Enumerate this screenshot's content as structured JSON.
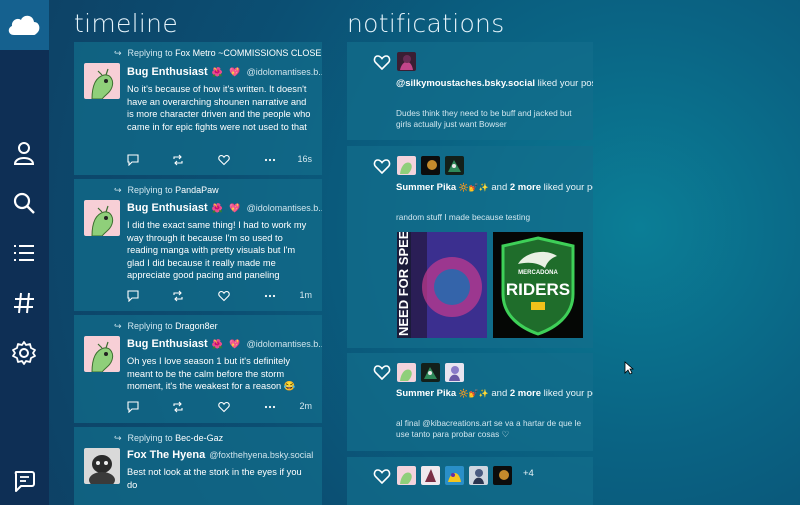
{
  "sections": {
    "timeline": "timeline",
    "notifications": "notifications"
  },
  "sidebar": {
    "items": [
      {
        "icon": "profile-icon"
      },
      {
        "icon": "search-icon"
      },
      {
        "icon": "list-icon"
      },
      {
        "icon": "hashtag-icon"
      },
      {
        "icon": "gear-icon"
      },
      {
        "icon": "compose-message-icon"
      }
    ]
  },
  "timeline": {
    "posts": [
      {
        "replying_to_label": "Replying to",
        "replying_to": "Fox Metro ~COMMISSIONS CLOSE...",
        "name": "Bug Enthusiast",
        "emoji": "🌺 💖",
        "handle": "@idolomantises.b...",
        "text": "No it's because of how it's written. It doesn't have an overarching shounen narrative and is more character driven and the people who came in for epic fights were not used to that",
        "time": "16s"
      },
      {
        "replying_to_label": "Replying to",
        "replying_to": "PandaPaw",
        "name": "Bug Enthusiast",
        "emoji": "🌺 💖",
        "handle": "@idolomantises.b...",
        "text": "I did the exact same thing! I had to work my way through it because I'm so used to reading manga with pretty visuals but I'm glad I did because it really made me appreciate good pacing and paneling",
        "time": "1m"
      },
      {
        "replying_to_label": "Replying to",
        "replying_to": "Dragon8er",
        "name": "Bug Enthusiast",
        "emoji": "🌺 💖",
        "handle": "@idolomantises.b...",
        "text": "Oh yes I love season 1 but it's definitely meant to be the calm before the storm moment, it's the weakest for a reason 😂",
        "time": "2m"
      },
      {
        "replying_to_label": "Replying to",
        "replying_to": "Bec-de-Gaz",
        "name": "Fox The Hyena",
        "emoji": "",
        "handle": "@foxthehyena.bsky.social",
        "text": "Best not look at the stork in the eyes if you do",
        "time": ""
      }
    ]
  },
  "notifications": {
    "items": [
      {
        "actor": "@silkymoustaches.bsky.social",
        "action": "liked your post",
        "more": "",
        "post": "Dudes think they need to be buff and jacked but girls actually just want Bowser"
      },
      {
        "actor": "Summer Pika",
        "emoji": "🔆💅✨",
        "and": "and",
        "more": "2 more",
        "action": "liked your post",
        "post": "random stuff I made because testing",
        "media": [
          {
            "alt": "NEED FOR SPEED artwork"
          },
          {
            "alt": "MERCADONA RIDERS logo"
          }
        ]
      },
      {
        "actor": "Summer Pika",
        "emoji": "🔆💅✨",
        "and": "and",
        "more": "2 more",
        "action": "liked your post",
        "post": "al final @kibacreations.art se va a hartar de que le use tanto para probar cosas ♡"
      },
      {
        "extra": "+4"
      }
    ]
  },
  "media_text": {
    "nfs": "NEED FOR SPEED",
    "mercadona": "MERCADONA",
    "riders": "RIDERS"
  },
  "colors": {
    "accent": "#1c7aa8",
    "card": "#127394",
    "sidebar": "#0e2f55"
  }
}
